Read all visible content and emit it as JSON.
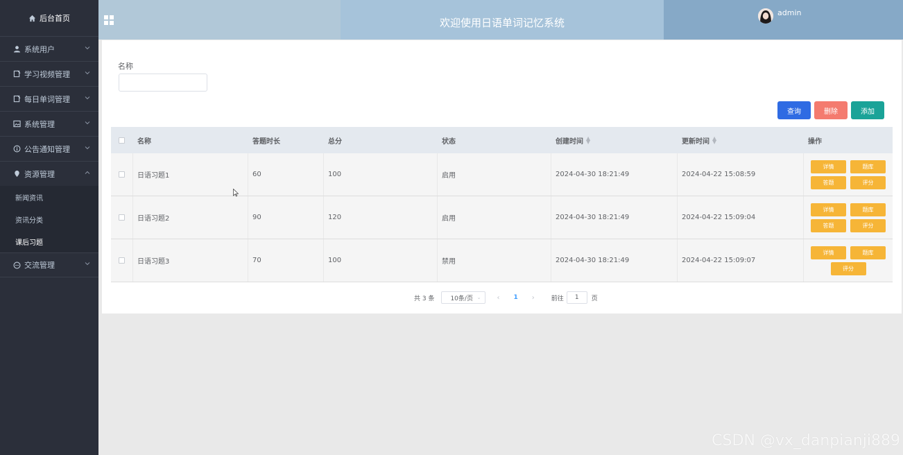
{
  "sidebar": {
    "home": "后台首页",
    "items": [
      {
        "label": "系统用户",
        "icon": "user-icon"
      },
      {
        "label": "学习视频管理",
        "icon": "document-icon"
      },
      {
        "label": "每日单词管理",
        "icon": "document-icon"
      },
      {
        "label": "系统管理",
        "icon": "image-icon"
      },
      {
        "label": "公告通知管理",
        "icon": "info-icon"
      },
      {
        "label": "资源管理",
        "icon": "location-icon"
      }
    ],
    "sub_items": [
      "新闻资讯",
      "资讯分类",
      "课后习题"
    ],
    "last_item": {
      "label": "交流管理",
      "icon": "chat-icon"
    }
  },
  "header": {
    "title": "欢迎使用日语单词记忆系统",
    "username": "admin"
  },
  "filter": {
    "name_label": "名称",
    "name_value": ""
  },
  "actions": {
    "query": "查询",
    "delete": "删除",
    "add": "添加"
  },
  "table": {
    "columns": [
      "名称",
      "答题时长",
      "总分",
      "状态",
      "创建时间",
      "更新时间",
      "操作"
    ],
    "rows": [
      {
        "name": "日语习题1",
        "duration": "60",
        "total": "100",
        "status": "启用",
        "created": "2024-04-30 18:21:49",
        "updated": "2024-04-22 15:08:59",
        "ops": [
          "详情",
          "题库",
          "答题",
          "评分"
        ]
      },
      {
        "name": "日语习题2",
        "duration": "90",
        "total": "120",
        "status": "启用",
        "created": "2024-04-30 18:21:49",
        "updated": "2024-04-22 15:09:04",
        "ops": [
          "详情",
          "题库",
          "答题",
          "评分"
        ]
      },
      {
        "name": "日语习题3",
        "duration": "70",
        "total": "100",
        "status": "禁用",
        "created": "2024-04-30 18:21:49",
        "updated": "2024-04-22 15:09:07",
        "ops": [
          "详情",
          "题库",
          "评分"
        ]
      }
    ]
  },
  "pagination": {
    "total_text": "共 3 条",
    "page_size": "10条/页",
    "current_page": "1",
    "goto_label": "前往",
    "goto_value": "1",
    "page_suffix": "页"
  },
  "watermark": "CSDN @vx_danpianji889",
  "colors": {
    "sidebar_bg": "#2b2f3a",
    "query_btn": "#2f6be3",
    "delete_btn": "#f47b6f",
    "add_btn": "#1aa398",
    "op_btn": "#f6b537"
  }
}
